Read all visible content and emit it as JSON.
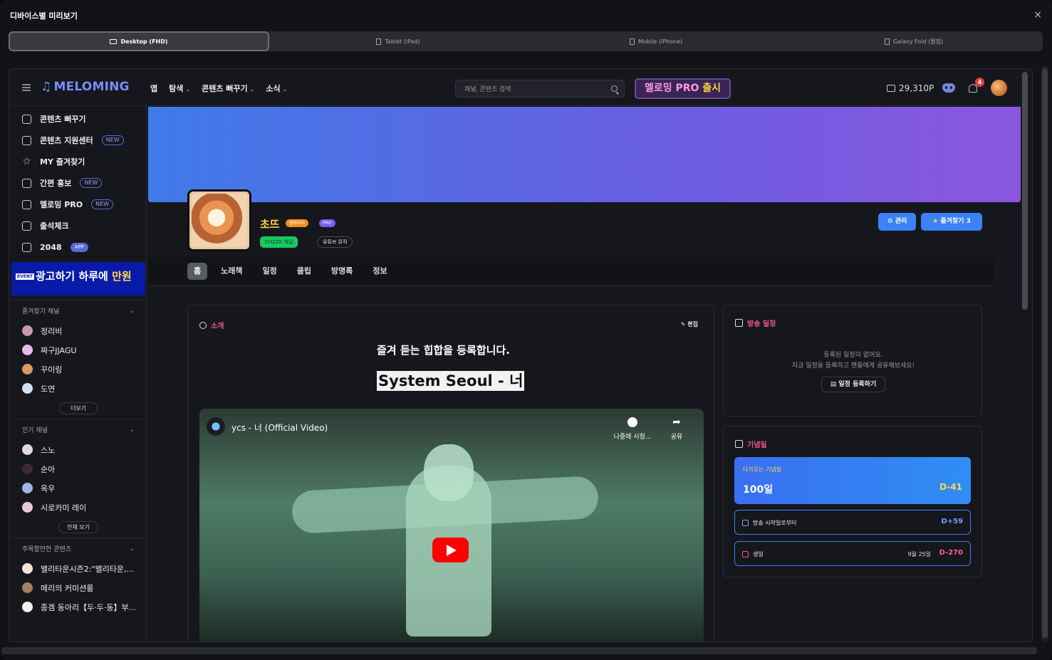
{
  "dialog": {
    "title": "디바이스별 미리보기",
    "close": "×"
  },
  "device_tabs": [
    {
      "label": "Desktop (FHD)"
    },
    {
      "label": "Tablet (iPad)"
    },
    {
      "label": "Mobile (iPhone)"
    },
    {
      "label": "Galaxy Fold (펼침)"
    }
  ],
  "header": {
    "logo": "MELOMING",
    "nav": [
      "앱",
      "탐색",
      "콘텐츠 뻐꾸기",
      "소식"
    ],
    "search_placeholder": "채널, 콘텐츠 검색",
    "pro_banner_a": "멜로밍 PRO",
    "pro_banner_b": "출시",
    "points": "29,310P",
    "notifications": "4"
  },
  "sidebar": {
    "menu": [
      {
        "label": "콘텐츠 뻐꾸기",
        "tag": ""
      },
      {
        "label": "콘텐츠 지원센터",
        "tag": "NEW"
      },
      {
        "label": "MY 즐겨찾기",
        "tag": ""
      },
      {
        "label": "간편 홍보",
        "tag": "NEW"
      },
      {
        "label": "멜로밍 PRO",
        "tag": "NEW"
      },
      {
        "label": "출석체크",
        "tag": ""
      },
      {
        "label": "2048",
        "tag": "APP"
      }
    ],
    "ad": {
      "event": "EVENT",
      "text_a": "광고하기 하루에",
      "text_b": "만원"
    },
    "fav_section": "즐겨찾기 채널",
    "fav_channels": [
      "정리비",
      "짜구JJAGU",
      "꾸이링",
      "도연"
    ],
    "fav_more": "더보기",
    "popular_section": "인기 채널",
    "popular_channels": [
      "스노",
      "순아",
      "옥우",
      "시로카미 레이"
    ],
    "popular_more": "전체 보기",
    "notable_section": "주목할만한 콘텐츠",
    "notable_items": [
      "밸리타운시즌2:\"밸리타운,...",
      "메리의 커미션룸",
      "종겜 동아리【두·두·동】부..."
    ]
  },
  "profile": {
    "name": "초뜨",
    "badge_ambassador": "앰배서더",
    "badge_pro": "PRO",
    "chzzk": "CHZZK 채널",
    "youtube_music": "유튜브 뮤직",
    "manage": "관리",
    "favorite": "즐겨찾기 3"
  },
  "tabs": [
    "홈",
    "노래책",
    "일정",
    "클립",
    "방명록",
    "정보"
  ],
  "intro": {
    "title": "소개",
    "edit": "편집",
    "line1": "즐겨 듣는 힙합을 등록합니다.",
    "line2": "System Seoul - 너",
    "video_title": "ycs - 너 (Official Video)",
    "watch_later": "나중에 시청...",
    "share": "공유"
  },
  "schedule": {
    "title": "방송 일정",
    "empty1": "등록된 일정이 없어요.",
    "empty2": "지금 일정을 등록하고 팬들에게 공유해보세요!",
    "register": "일정 등록하기"
  },
  "anniversary": {
    "title": "기념일",
    "upcoming_label": "다가오는 기념일",
    "upcoming_name": "100일",
    "upcoming_d": "D-41",
    "since_label": "방송 시작일로부터",
    "since_d": "D+59",
    "birthday_label": "생일",
    "birthday_date": "9월 25일",
    "birthday_d": "D-270"
  },
  "colors": {
    "accent": "#3b82f6",
    "pink": "#ef5a8a",
    "gold": "#ffd23f",
    "logo": "#7a8cff"
  }
}
